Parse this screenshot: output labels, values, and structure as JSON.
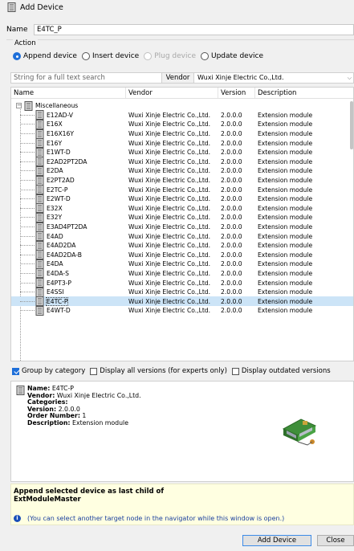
{
  "window": {
    "title": "Add Device",
    "icon": "device-icon"
  },
  "name_field": {
    "label": "Name",
    "value": "E4TC_P"
  },
  "action": {
    "legend": "Action",
    "options": [
      {
        "label": "Append device",
        "checked": true,
        "disabled": false
      },
      {
        "label": "Insert device",
        "checked": false,
        "disabled": false
      },
      {
        "label": "Plug device",
        "checked": false,
        "disabled": true
      },
      {
        "label": "Update device",
        "checked": false,
        "disabled": false
      }
    ]
  },
  "search": {
    "placeholder": "String for a full text search",
    "vendor_label": "Vendor",
    "vendor_value": "Wuxi Xinje Electric Co.,Ltd."
  },
  "table": {
    "columns": [
      "Name",
      "Vendor",
      "Version",
      "Description"
    ],
    "group": {
      "label": "Miscellaneous",
      "expander": "−"
    },
    "rows": [
      {
        "name": "E12AD-V",
        "vendor": "Wuxi Xinje Electric Co.,Ltd.",
        "version": "2.0.0.0",
        "description": "Extension module"
      },
      {
        "name": "E16X",
        "vendor": "Wuxi Xinje Electric Co.,Ltd.",
        "version": "2.0.0.0",
        "description": "Extension module"
      },
      {
        "name": "E16X16Y",
        "vendor": "Wuxi Xinje Electric Co.,Ltd.",
        "version": "2.0.0.0",
        "description": "Extension module"
      },
      {
        "name": "E16Y",
        "vendor": "Wuxi Xinje Electric Co.,Ltd.",
        "version": "2.0.0.0",
        "description": "Extension module"
      },
      {
        "name": "E1WT-D",
        "vendor": "Wuxi Xinje Electric Co.,Ltd.",
        "version": "2.0.0.0",
        "description": "Extension module"
      },
      {
        "name": "E2AD2PT2DA",
        "vendor": "Wuxi Xinje Electric Co.,Ltd.",
        "version": "2.0.0.0",
        "description": "Extension module"
      },
      {
        "name": "E2DA",
        "vendor": "Wuxi Xinje Electric Co.,Ltd.",
        "version": "2.0.0.0",
        "description": "Extension module"
      },
      {
        "name": "E2PT2AD",
        "vendor": "Wuxi Xinje Electric Co.,Ltd.",
        "version": "2.0.0.0",
        "description": "Extension module"
      },
      {
        "name": "E2TC-P",
        "vendor": "Wuxi Xinje Electric Co.,Ltd.",
        "version": "2.0.0.0",
        "description": "Extension module"
      },
      {
        "name": "E2WT-D",
        "vendor": "Wuxi Xinje Electric Co.,Ltd.",
        "version": "2.0.0.0",
        "description": "Extension module"
      },
      {
        "name": "E32X",
        "vendor": "Wuxi Xinje Electric Co.,Ltd.",
        "version": "2.0.0.0",
        "description": "Extension module"
      },
      {
        "name": "E32Y",
        "vendor": "Wuxi Xinje Electric Co.,Ltd.",
        "version": "2.0.0.0",
        "description": "Extension module"
      },
      {
        "name": "E3AD4PT2DA",
        "vendor": "Wuxi Xinje Electric Co.,Ltd.",
        "version": "2.0.0.0",
        "description": "Extension module"
      },
      {
        "name": "E4AD",
        "vendor": "Wuxi Xinje Electric Co.,Ltd.",
        "version": "2.0.0.0",
        "description": "Extension module"
      },
      {
        "name": "E4AD2DA",
        "vendor": "Wuxi Xinje Electric Co.,Ltd.",
        "version": "2.0.0.0",
        "description": "Extension module"
      },
      {
        "name": "E4AD2DA-B",
        "vendor": "Wuxi Xinje Electric Co.,Ltd.",
        "version": "2.0.0.0",
        "description": "Extension module"
      },
      {
        "name": "E4DA",
        "vendor": "Wuxi Xinje Electric Co.,Ltd.",
        "version": "2.0.0.0",
        "description": "Extension module"
      },
      {
        "name": "E4DA-S",
        "vendor": "Wuxi Xinje Electric Co.,Ltd.",
        "version": "2.0.0.0",
        "description": "Extension module"
      },
      {
        "name": "E4PT3-P",
        "vendor": "Wuxi Xinje Electric Co.,Ltd.",
        "version": "2.0.0.0",
        "description": "Extension module"
      },
      {
        "name": "E4SSI",
        "vendor": "Wuxi Xinje Electric Co.,Ltd.",
        "version": "2.0.0.0",
        "description": "Extension module"
      },
      {
        "name": "E4TC-P",
        "vendor": "Wuxi Xinje Electric Co.,Ltd.",
        "version": "2.0.0.0",
        "description": "Extension module",
        "selected": true
      },
      {
        "name": "E4WT-D",
        "vendor": "Wuxi Xinje Electric Co.,Ltd.",
        "version": "2.0.0.0",
        "description": "Extension module"
      }
    ]
  },
  "options": [
    {
      "label": "Group by category",
      "checked": true
    },
    {
      "label": "Display all versions (for experts only)",
      "checked": false
    },
    {
      "label": "Display outdated versions",
      "checked": false
    }
  ],
  "details": {
    "name_label": "Name:",
    "name_value": "E4TC-P",
    "vendor_label": "Vendor:",
    "vendor_value": "Wuxi Xinje Electric Co.,Ltd.",
    "categories_label": "Categories:",
    "version_label": "Version:",
    "version_value": "2.0.0.0",
    "order_label": "Order Number:",
    "order_value": "1",
    "description_label": "Description:",
    "description_value": "Extension module",
    "preview_icon": "device-module-image"
  },
  "message": {
    "title_line1": "Append selected device as last child of",
    "title_line2": "ExtModuleMaster",
    "note": "(You can select another target node in the navigator while this window is open.)",
    "note_icon": "info-icon"
  },
  "buttons": {
    "add": "Add Device",
    "close": "Close"
  },
  "colors": {
    "accent": "#1e6fd9",
    "selection": "#cce4f7",
    "message_bg": "#ffffe1"
  }
}
